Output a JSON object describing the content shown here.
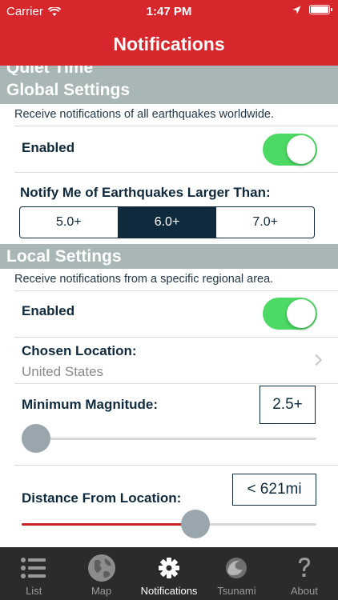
{
  "status_bar": {
    "carrier": "Carrier",
    "time": "1:47 PM"
  },
  "nav": {
    "title": "Notifications"
  },
  "quiet_time": {
    "title": "Quiet Time"
  },
  "global": {
    "title": "Global Settings",
    "description": "Receive notifications of all earthquakes worldwide.",
    "enabled_label": "Enabled",
    "enabled": true,
    "notify_label": "Notify Me of Earthquakes Larger Than:",
    "options": [
      "5.0+",
      "6.0+",
      "7.0+"
    ],
    "selected_option": "6.0+"
  },
  "local": {
    "title": "Local Settings",
    "description": "Receive notifications from a specific regional area.",
    "enabled_label": "Enabled",
    "enabled": true,
    "location_label": "Chosen Location:",
    "location_value": "United States",
    "min_magnitude_label": "Minimum Magnitude:",
    "min_magnitude_value": "2.5+",
    "min_magnitude_fraction": 0.0,
    "distance_label": "Distance From Location:",
    "distance_value": "< 621mi",
    "distance_fraction": 0.6
  },
  "tabs": [
    {
      "label": "List",
      "icon": "list-icon"
    },
    {
      "label": "Map",
      "icon": "globe-icon"
    },
    {
      "label": "Notifications",
      "icon": "gear-icon",
      "active": true
    },
    {
      "label": "Tsunami",
      "icon": "wave-icon"
    },
    {
      "label": "About",
      "icon": "question-icon"
    }
  ],
  "colors": {
    "brand_red": "#d8262d",
    "navy": "#0f2a3d",
    "section_gray": "#a8b7b5",
    "toggle_green": "#4cd964"
  }
}
